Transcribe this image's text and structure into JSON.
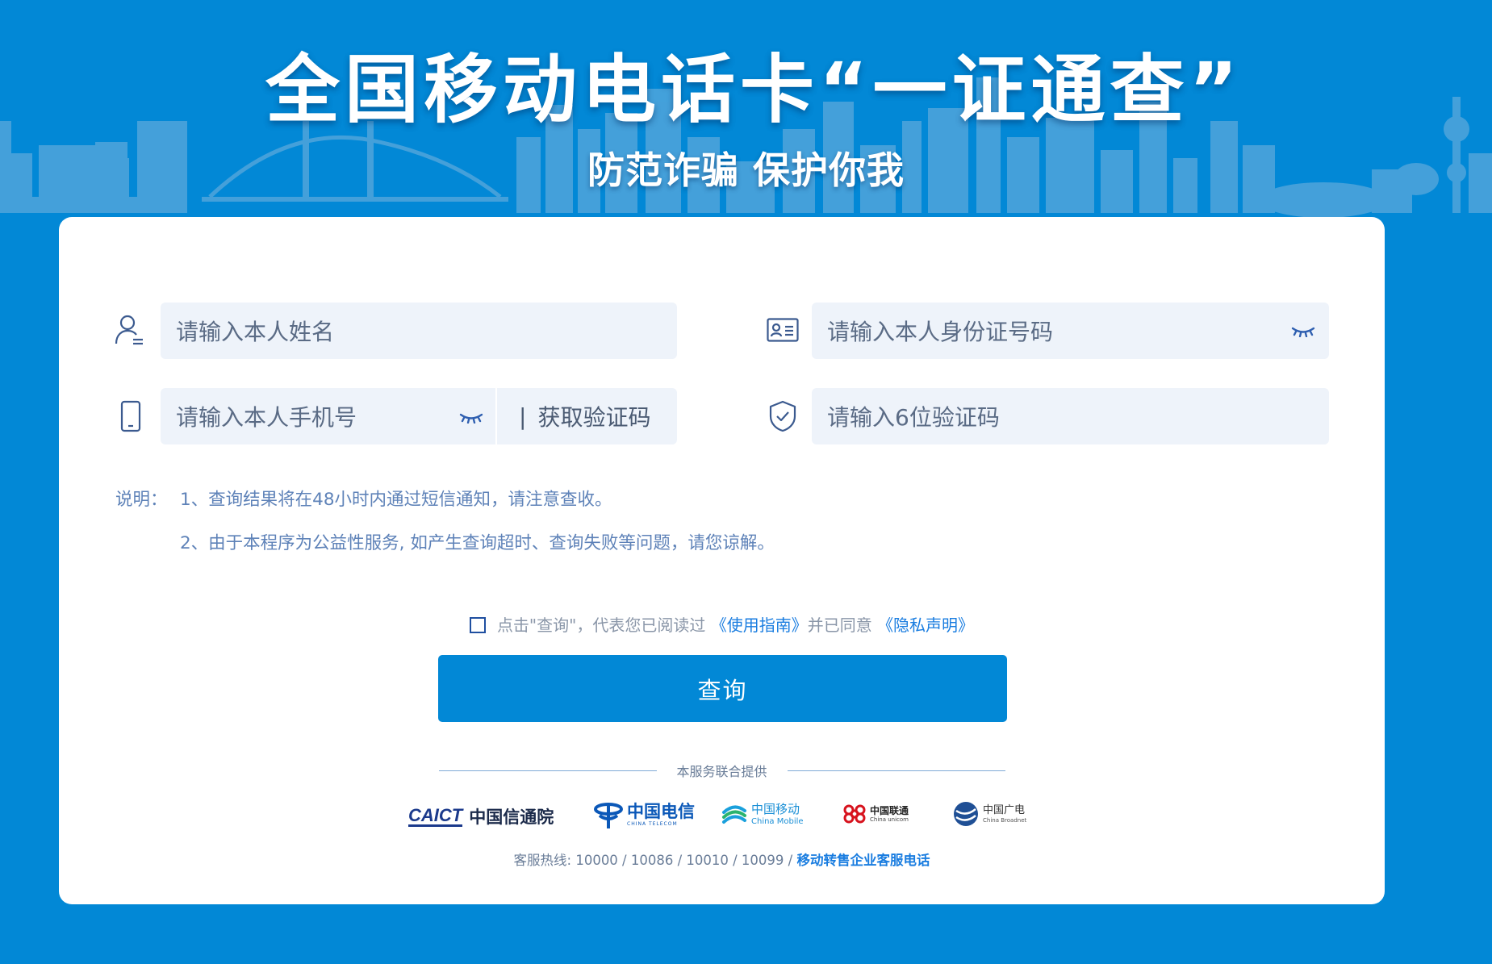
{
  "banner": {
    "title": "全国移动电话卡“一证通查”",
    "subtitle": "防范诈骗 保护你我"
  },
  "form": {
    "name": {
      "placeholder": "请输入本人姓名",
      "icon": "user-icon"
    },
    "id_card": {
      "placeholder": "请输入本人身份证号码",
      "icon": "id-card-icon",
      "toggle_icon": "eye-closed-icon"
    },
    "phone": {
      "placeholder": "请输入本人手机号",
      "icon": "phone-icon",
      "toggle_icon": "eye-closed-icon",
      "separator": "|",
      "get_code_label": "获取验证码"
    },
    "code": {
      "placeholder": "请输入6位验证码",
      "icon": "shield-check-icon"
    }
  },
  "notes": {
    "label": "说明：",
    "items": [
      "1、查询结果将在48小时内通过短信通知，请注意查收。",
      "2、由于本程序为公益性服务, 如产生查询超时、查询失败等问题，请您谅解。"
    ]
  },
  "agreement": {
    "checked": false,
    "text_before": "点击\"查询\"，代表您已阅读过",
    "guide_link": "《使用指南》",
    "text_middle": "并已同意",
    "privacy_link": "《隐私声明》"
  },
  "submit_label": "查询",
  "providers": {
    "label": "本服务联合提供",
    "logos": [
      {
        "name": "caict",
        "text_en": "CAICT",
        "text_cn": "中国信通院"
      },
      {
        "name": "china-telecom",
        "text_cn": "中国电信",
        "text_en": "CHINA TELECOM"
      },
      {
        "name": "china-mobile",
        "text_cn": "中国移动",
        "text_en": "China Mobile"
      },
      {
        "name": "china-unicom",
        "text_cn": "中国联通",
        "text_en": "China unicom"
      },
      {
        "name": "china-broadnet",
        "text_cn": "中国广电",
        "text_en": "China Broadnet"
      }
    ]
  },
  "hotline": {
    "prefix": "客服热线: 10000 / 10086 / 10010 / 10099 /",
    "link": "移动转售企业客服电话"
  },
  "colors": {
    "brand_blue": "#0288d6",
    "field_bg": "#eef3fa",
    "link": "#1a7de0",
    "note_text": "#5e82b8"
  }
}
